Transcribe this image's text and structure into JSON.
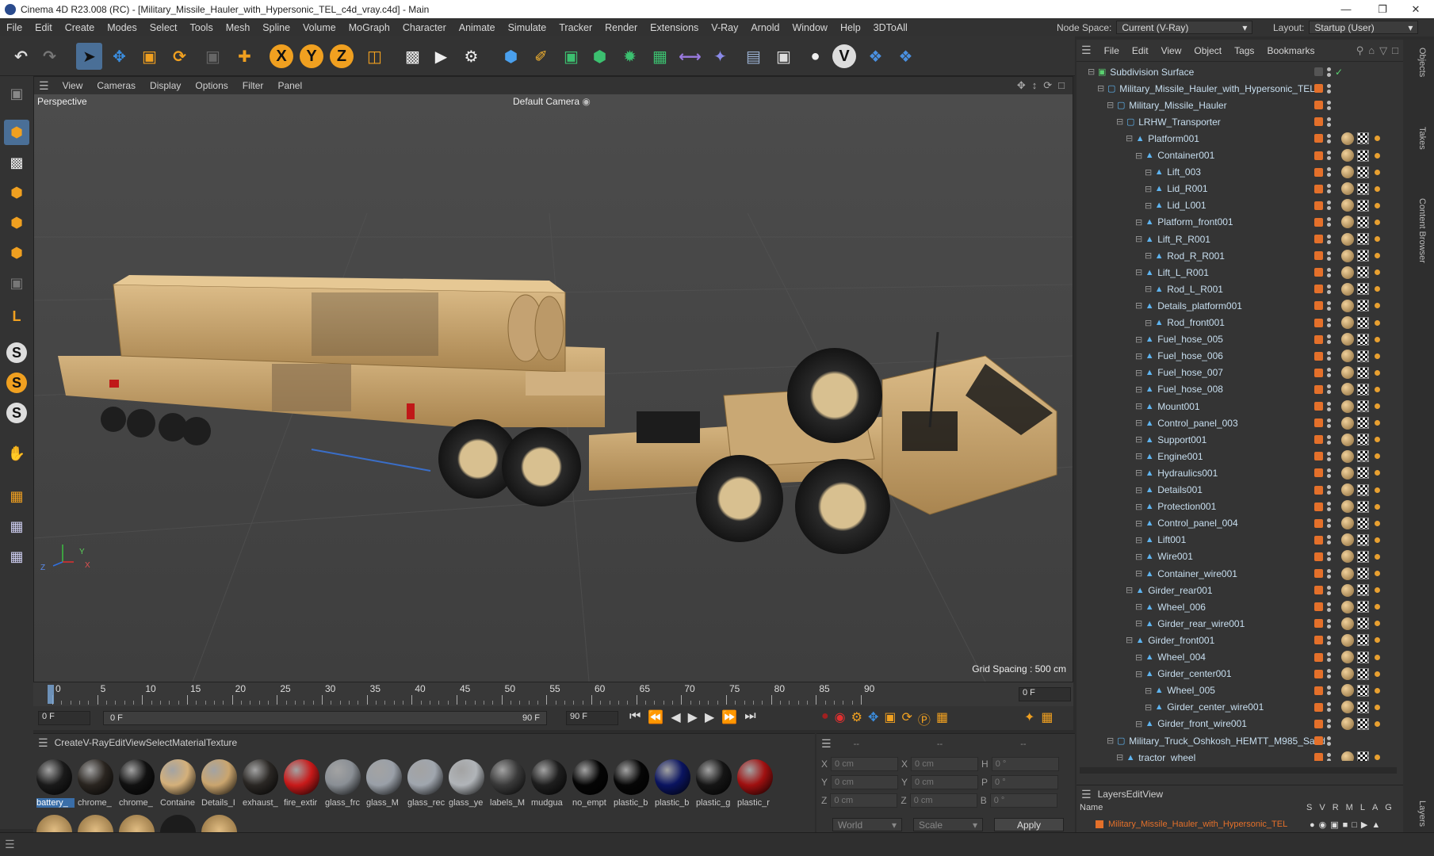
{
  "window": {
    "title": "Cinema 4D R23.008 (RC) - [Military_Missile_Hauler_with_Hypersonic_TEL_c4d_vray.c4d] - Main"
  },
  "menubar": {
    "items": [
      "File",
      "Edit",
      "Create",
      "Modes",
      "Select",
      "Tools",
      "Mesh",
      "Spline",
      "Volume",
      "MoGraph",
      "Character",
      "Animate",
      "Simulate",
      "Tracker",
      "Render",
      "Extensions",
      "V-Ray",
      "Arnold",
      "Window",
      "Help",
      "3DToAll"
    ],
    "node_space_label": "Node Space:",
    "node_space_value": "Current (V-Ray)",
    "layout_label": "Layout:",
    "layout_value": "Startup (User)"
  },
  "viewport": {
    "menu": [
      "View",
      "Cameras",
      "Display",
      "Options",
      "Filter",
      "Panel"
    ],
    "view_name": "Perspective",
    "camera": "Default Camera",
    "grid_spacing": "Grid Spacing : 500 cm",
    "axis": {
      "x": "X",
      "y": "Y",
      "z": "Z"
    }
  },
  "timeline": {
    "ticks": [
      "0",
      "5",
      "10",
      "15",
      "20",
      "25",
      "30",
      "35",
      "40",
      "45",
      "50",
      "55",
      "60",
      "65",
      "70",
      "75",
      "80",
      "85",
      "90"
    ],
    "current_frame": "0 F"
  },
  "transport": {
    "start": "0 F",
    "slider_start": "0 F",
    "slider_end": "90 F",
    "end": "90 F"
  },
  "material_manager": {
    "menu": [
      "Create",
      "V-Ray",
      "Edit",
      "View",
      "Select",
      "Material",
      "Texture"
    ],
    "materials": [
      {
        "label": "battery_",
        "color": "#1a1a1a"
      },
      {
        "label": "chrome_",
        "color": "#2a2520"
      },
      {
        "label": "chrome_",
        "color": "#111111"
      },
      {
        "label": "Containe",
        "color": "#d4b07a"
      },
      {
        "label": "Details_I",
        "color": "#caa56e"
      },
      {
        "label": "exhaust_",
        "color": "#2a2724"
      },
      {
        "label": "fire_extir",
        "color": "#c81a1a"
      },
      {
        "label": "glass_frc",
        "color": "#8a8f95"
      },
      {
        "label": "glass_M",
        "color": "#9aa0a8"
      },
      {
        "label": "glass_rec",
        "color": "#a0a6ae"
      },
      {
        "label": "glass_ye",
        "color": "#b0b4b8"
      },
      {
        "label": "labels_M",
        "color": "#3a3a3a"
      },
      {
        "label": "mudgua",
        "color": "#1e1e1e"
      },
      {
        "label": "no_empt",
        "color": "#050505"
      },
      {
        "label": "plastic_b",
        "color": "#060606"
      },
      {
        "label": "plastic_b",
        "color": "#0a1460"
      },
      {
        "label": "plastic_g",
        "color": "#151515"
      },
      {
        "label": "plastic_r",
        "color": "#a01010"
      }
    ]
  },
  "coords": {
    "rows": [
      {
        "a": "X",
        "av": "0 cm",
        "b": "X",
        "bv": "0 cm",
        "c": "H",
        "cv": "0 °"
      },
      {
        "a": "Y",
        "av": "0 cm",
        "b": "Y",
        "bv": "0 cm",
        "c": "P",
        "cv": "0 °"
      },
      {
        "a": "Z",
        "av": "0 cm",
        "b": "Z",
        "bv": "0 cm",
        "c": "B",
        "cv": "0 °"
      }
    ],
    "mode1": "World",
    "mode2": "Scale",
    "apply": "Apply",
    "header1": "--",
    "header2": "--",
    "header3": "--"
  },
  "object_manager": {
    "menu": [
      "File",
      "Edit",
      "View",
      "Object",
      "Tags",
      "Bookmarks"
    ],
    "objects": [
      {
        "name": "Subdivision Surface",
        "depth": 0,
        "kind": "sub"
      },
      {
        "name": "Military_Missile_Hauler_with_Hypersonic_TEL",
        "depth": 1,
        "kind": "null"
      },
      {
        "name": "Military_Missile_Hauler",
        "depth": 2,
        "kind": "null"
      },
      {
        "name": "LRHW_Transporter",
        "depth": 3,
        "kind": "null"
      },
      {
        "name": "Platform001",
        "depth": 4,
        "kind": "poly"
      },
      {
        "name": "Container001",
        "depth": 5,
        "kind": "poly"
      },
      {
        "name": "Lift_003",
        "depth": 6,
        "kind": "poly"
      },
      {
        "name": "Lid_R001",
        "depth": 6,
        "kind": "poly"
      },
      {
        "name": "Lid_L001",
        "depth": 6,
        "kind": "poly"
      },
      {
        "name": "Platform_front001",
        "depth": 5,
        "kind": "poly"
      },
      {
        "name": "Lift_R_R001",
        "depth": 5,
        "kind": "poly"
      },
      {
        "name": "Rod_R_R001",
        "depth": 6,
        "kind": "poly"
      },
      {
        "name": "Lift_L_R001",
        "depth": 5,
        "kind": "poly"
      },
      {
        "name": "Rod_L_R001",
        "depth": 6,
        "kind": "poly"
      },
      {
        "name": "Details_platform001",
        "depth": 5,
        "kind": "poly"
      },
      {
        "name": "Rod_front001",
        "depth": 6,
        "kind": "poly"
      },
      {
        "name": "Fuel_hose_005",
        "depth": 5,
        "kind": "poly"
      },
      {
        "name": "Fuel_hose_006",
        "depth": 5,
        "kind": "poly"
      },
      {
        "name": "Fuel_hose_007",
        "depth": 5,
        "kind": "poly"
      },
      {
        "name": "Fuel_hose_008",
        "depth": 5,
        "kind": "poly"
      },
      {
        "name": "Mount001",
        "depth": 5,
        "kind": "poly"
      },
      {
        "name": "Control_panel_003",
        "depth": 5,
        "kind": "poly"
      },
      {
        "name": "Support001",
        "depth": 5,
        "kind": "poly"
      },
      {
        "name": "Engine001",
        "depth": 5,
        "kind": "poly"
      },
      {
        "name": "Hydraulics001",
        "depth": 5,
        "kind": "poly"
      },
      {
        "name": "Details001",
        "depth": 5,
        "kind": "poly"
      },
      {
        "name": "Protection001",
        "depth": 5,
        "kind": "poly"
      },
      {
        "name": "Control_panel_004",
        "depth": 5,
        "kind": "poly"
      },
      {
        "name": "Lift001",
        "depth": 5,
        "kind": "poly"
      },
      {
        "name": "Wire001",
        "depth": 5,
        "kind": "poly"
      },
      {
        "name": "Container_wire001",
        "depth": 5,
        "kind": "poly"
      },
      {
        "name": "Girder_rear001",
        "depth": 4,
        "kind": "poly"
      },
      {
        "name": "Wheel_006",
        "depth": 5,
        "kind": "poly"
      },
      {
        "name": "Girder_rear_wire001",
        "depth": 5,
        "kind": "poly"
      },
      {
        "name": "Girder_front001",
        "depth": 4,
        "kind": "poly"
      },
      {
        "name": "Wheel_004",
        "depth": 5,
        "kind": "poly"
      },
      {
        "name": "Girder_center001",
        "depth": 5,
        "kind": "poly"
      },
      {
        "name": "Wheel_005",
        "depth": 6,
        "kind": "poly"
      },
      {
        "name": "Girder_center_wire001",
        "depth": 6,
        "kind": "poly"
      },
      {
        "name": "Girder_front_wire001",
        "depth": 5,
        "kind": "poly"
      },
      {
        "name": "Military_Truck_Oshkosh_HEMTT_M985_Sand",
        "depth": 2,
        "kind": "null"
      },
      {
        "name": "tractor_wheel",
        "depth": 3,
        "kind": "poly"
      }
    ]
  },
  "layer_manager": {
    "menu": [
      "Layers",
      "Edit",
      "View"
    ],
    "name_header": "Name",
    "columns": [
      "S",
      "V",
      "R",
      "M",
      "L",
      "A",
      "G"
    ],
    "layer": "Military_Missile_Hauler_with_Hypersonic_TEL"
  },
  "right_tabs": [
    "Objects",
    "Takes",
    "Content Browser",
    "Layers"
  ],
  "colors": {
    "accent": "#3a6ea8",
    "tag_orange": "#e4702a",
    "sand": "#cba670"
  }
}
